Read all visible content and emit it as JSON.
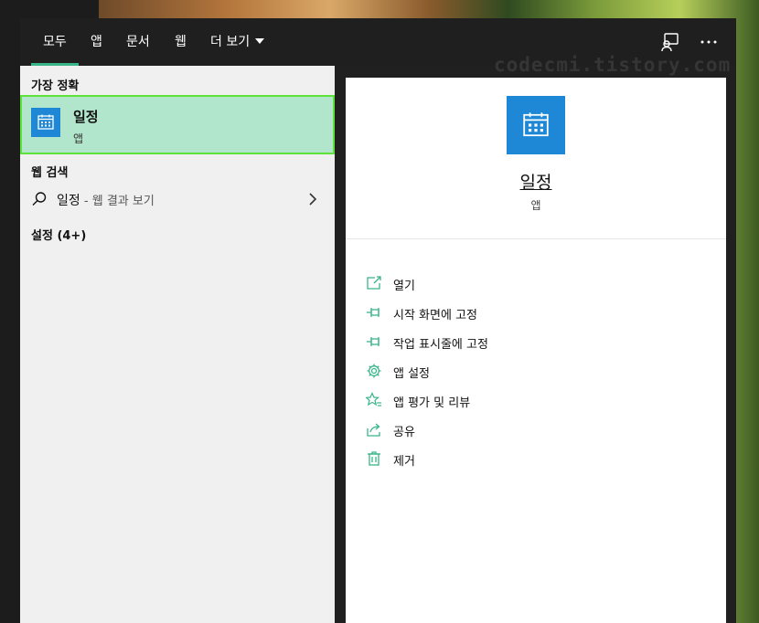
{
  "tabs": [
    {
      "label": "모두",
      "active": true
    },
    {
      "label": "앱"
    },
    {
      "label": "문서"
    },
    {
      "label": "웹"
    },
    {
      "label": "더 보기"
    }
  ],
  "watermark": "codecmi.tistory.com",
  "left": {
    "best_match_title": "가장 정확",
    "best_match": {
      "name": "일정",
      "type": "앱"
    },
    "web_search_title": "웹 검색",
    "web_query": "일정",
    "web_suffix": " - 웹 결과 보기",
    "settings_title": "설정 (4+)"
  },
  "right": {
    "app_name": "일정",
    "app_type": "앱",
    "actions": [
      "열기",
      "시작 화면에 고정",
      "작업 표시줄에 고정",
      "앱 설정",
      "앱 평가 및 리뷰",
      "공유",
      "제거"
    ]
  },
  "colors": {
    "accent": "#3ab58a",
    "tile": "#1e88d6",
    "highlight": "#b2e6cc",
    "highlight_border": "#5fe33a"
  }
}
